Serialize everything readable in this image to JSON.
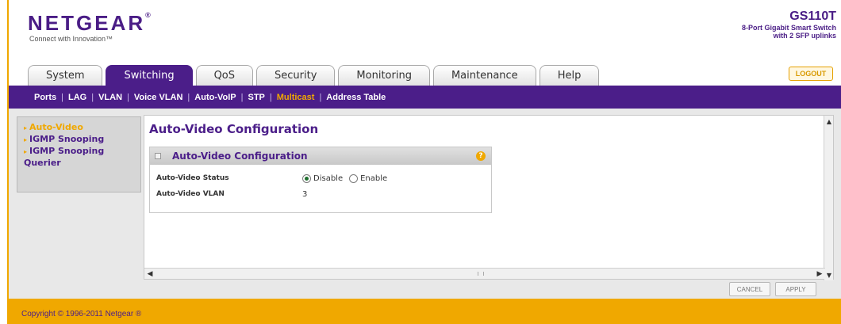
{
  "header": {
    "logo": "NETGEAR",
    "logo_mark": "®",
    "tagline": "Connect with Innovation™",
    "model": "GS110T",
    "description_line1": "8-Port Gigabit Smart Switch",
    "description_line2": "with 2 SFP uplinks",
    "logout_label": "LOGOUT"
  },
  "tabs": [
    {
      "label": "System"
    },
    {
      "label": "Switching"
    },
    {
      "label": "QoS"
    },
    {
      "label": "Security"
    },
    {
      "label": "Monitoring"
    },
    {
      "label": "Maintenance"
    },
    {
      "label": "Help"
    }
  ],
  "active_tab": "Switching",
  "subnav": [
    {
      "label": "Ports"
    },
    {
      "label": "LAG"
    },
    {
      "label": "VLAN"
    },
    {
      "label": "Voice VLAN"
    },
    {
      "label": "Auto-VoIP"
    },
    {
      "label": "STP"
    },
    {
      "label": "Multicast"
    },
    {
      "label": "Address Table"
    }
  ],
  "active_subnav": "Multicast",
  "sidebar": {
    "items": [
      {
        "label": "Auto-Video"
      },
      {
        "label": "IGMP Snooping"
      },
      {
        "label": "IGMP Snooping"
      },
      {
        "label": "Querier"
      }
    ]
  },
  "main": {
    "title": "Auto-Video Configuration",
    "panel_title": "Auto-Video Configuration",
    "help_icon": "?",
    "status_label": "Auto-Video Status",
    "status_options": [
      "Disable",
      "Enable"
    ],
    "status_selected": "Disable",
    "vlan_label": "Auto-Video VLAN",
    "vlan_value": "3"
  },
  "buttons": {
    "cancel": "CANCEL",
    "apply": "APPLY"
  },
  "footer": {
    "copyright": "Copyright © 1996-2011 Netgear ®"
  },
  "colors": {
    "brand_purple": "#4b1e89",
    "accent_orange": "#f0a800"
  },
  "icons": {
    "help": "help-icon",
    "scroll_up": "scroll-up-icon",
    "scroll_down": "scroll-down-icon",
    "scroll_left": "scroll-left-icon",
    "scroll_right": "scroll-right-icon"
  }
}
